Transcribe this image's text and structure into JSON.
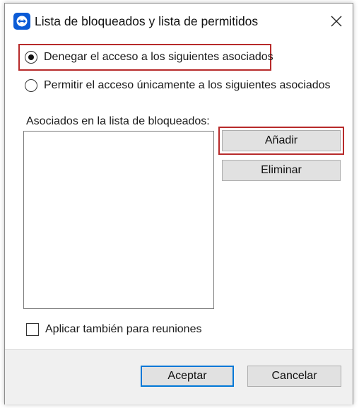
{
  "window": {
    "title": "Lista de bloqueados y lista de permitidos",
    "app_icon": "teamviewer-icon",
    "close_icon": "close-icon"
  },
  "options": [
    {
      "label": "Denegar el acceso a los siguientes asociados",
      "selected": true
    },
    {
      "label": "Permitir el acceso únicamente a los siguientes asociados",
      "selected": false
    }
  ],
  "partners": {
    "label": "Asociados en la lista de bloqueados:",
    "items": []
  },
  "buttons": {
    "add": "Añadir",
    "remove": "Eliminar",
    "accept": "Aceptar",
    "cancel": "Cancelar"
  },
  "meetings_checkbox": {
    "label": "Aplicar también para reuniones",
    "checked": false
  },
  "colors": {
    "highlight": "#b72a2a",
    "accent": "#0078d7",
    "app_icon_bg": "#0b5bd6"
  }
}
